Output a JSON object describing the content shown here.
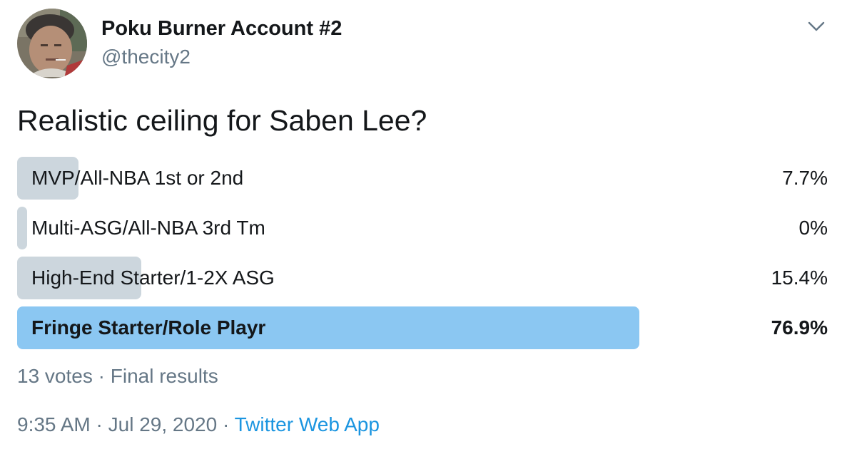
{
  "author": {
    "display_name": "Poku Burner Account #2",
    "handle": "@thecity2"
  },
  "tweet": {
    "text": "Realistic ceiling for Saben Lee?"
  },
  "poll": {
    "options": [
      {
        "label": "MVP/All-NBA 1st or 2nd",
        "percent": 7.7,
        "percent_label": "7.7%",
        "winner": false
      },
      {
        "label": "Multi-ASG/All-NBA 3rd Tm",
        "percent": 0,
        "percent_label": "0%",
        "winner": false
      },
      {
        "label": "High-End Starter/1-2X ASG",
        "percent": 15.4,
        "percent_label": "15.4%",
        "winner": false
      },
      {
        "label": "Fringe Starter/Role Playr",
        "percent": 76.9,
        "percent_label": "76.9%",
        "winner": true
      }
    ],
    "votes": "13 votes",
    "separator": "·",
    "status": "Final results"
  },
  "meta": {
    "time": "9:35 AM",
    "separator": "·",
    "date": "Jul 29, 2020",
    "source": "Twitter Web App"
  },
  "colors": {
    "bar": "#ccd6dd",
    "winner_bar": "#8bc7f2",
    "link": "#1b95e0",
    "secondary_text": "#657786"
  },
  "icons": {
    "menu_caret": "chevron-down-icon"
  }
}
